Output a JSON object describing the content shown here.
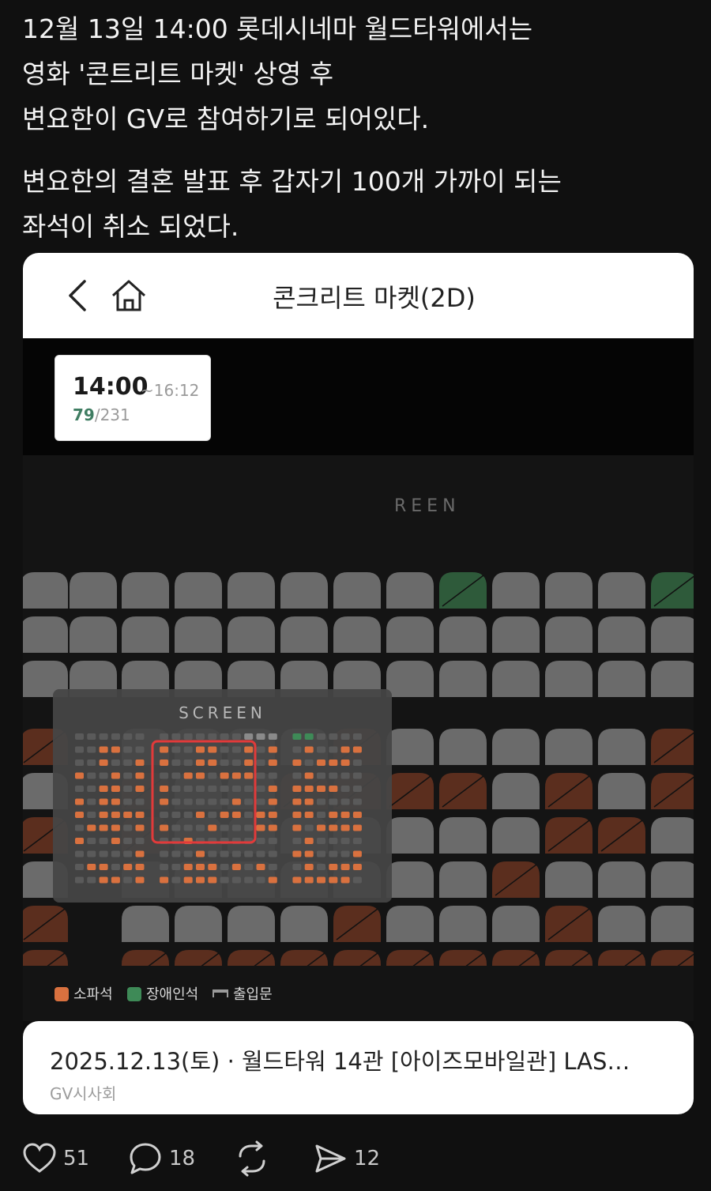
{
  "post": {
    "lines": [
      "12월 13일 14:00 롯데시네마 월드타워에서는",
      "영화 '콘트리트 마켓' 상영 후",
      "변요한이 GV로 참여하기로 되어있다.",
      "변요한의 결혼 발표 후 갑자기 100개 가까이 되는",
      "좌석이 취소 되었다."
    ]
  },
  "app": {
    "title": "콘크리트 마켓(2D)",
    "back_icon": "back-arrow-icon",
    "home_icon": "home-icon"
  },
  "showtime": {
    "start": "14:00",
    "end": "~16:12",
    "available": "79",
    "total": "/231"
  },
  "seatmap": {
    "screen_label": "SCREEN",
    "screen_partial": "REEN"
  },
  "legend": [
    {
      "label": "소파석",
      "color": "#d9713f"
    },
    {
      "label": "장애인석",
      "color": "#3e8a57"
    },
    {
      "label": "출입문",
      "color": "#9a9a9a"
    }
  ],
  "info": {
    "main": "2025.12.13(토) · 월드타워 14관 [아이즈모바일관] LAS…",
    "sub": "GV시사회"
  },
  "actions": {
    "likes": "51",
    "comments": "18",
    "shares": "12"
  },
  "colors": {
    "seat_available": "#6b6b6b",
    "seat_sold": "#5b2e1e",
    "seat_wheelchair": "#2e5a3a",
    "mini_sofa": "#d9713f",
    "mini_seat": "#5a5a5a",
    "highlight": "#e23a3a"
  }
}
